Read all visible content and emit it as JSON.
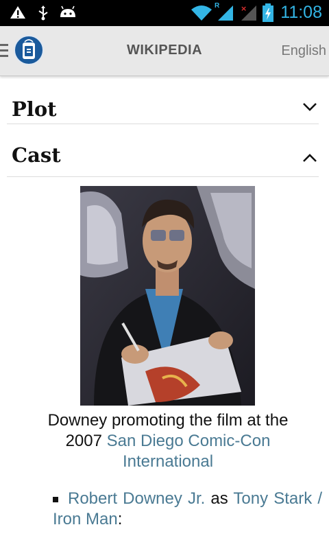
{
  "status_bar": {
    "time": "11:08",
    "icons": [
      "warning-icon",
      "usb-icon",
      "android-icon",
      "wifi-icon",
      "signal-icon",
      "signal-no-service-icon",
      "battery-charging-icon"
    ],
    "roaming_label": "R",
    "accent_color": "#33b5e5"
  },
  "app_bar": {
    "title": "WIKIPEDIA",
    "language": "English",
    "menu_icon": "menu-icon",
    "logo": "app-logo"
  },
  "sections": [
    {
      "title": "Plot",
      "expanded": false
    },
    {
      "title": "Cast",
      "expanded": true
    }
  ],
  "figure": {
    "caption_prefix": "Downey promoting the film at the 2007 ",
    "caption_link": "San Diego Comic-Con International"
  },
  "cast": {
    "item_1": {
      "actor": "Robert Downey Jr.",
      "connector": "as",
      "role": "Tony Stark / Iron Man",
      "suffix": ":"
    }
  },
  "colors": {
    "link": "#4a7a93",
    "app_bar_bg": "#e8e8e8",
    "logo_blue": "#1a5a9c"
  }
}
